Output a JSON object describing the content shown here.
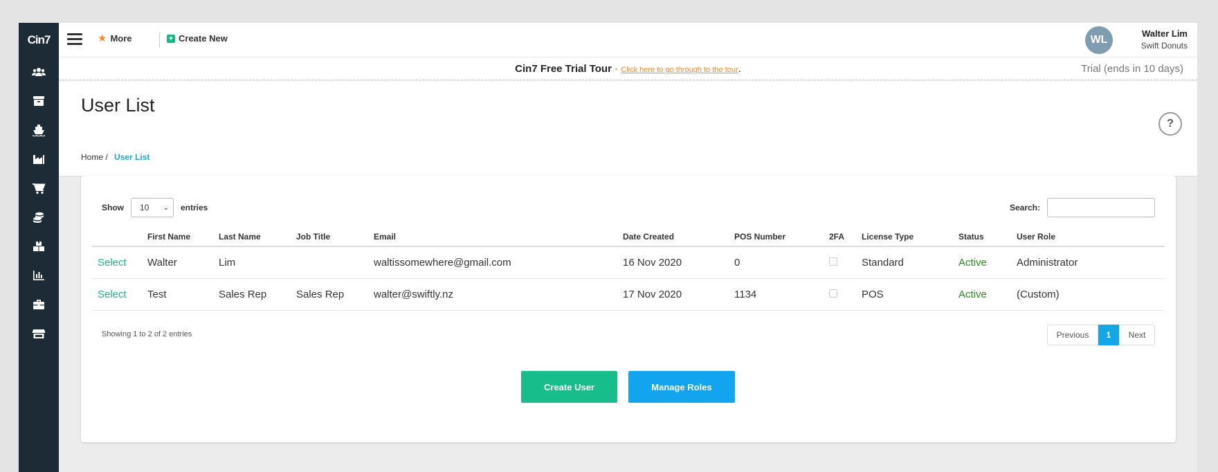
{
  "app": {
    "logo": "Cin7"
  },
  "sidebar": {
    "icons": [
      "users-icon",
      "box-icon",
      "ship-icon",
      "factory-icon",
      "cart-icon",
      "coins-icon",
      "warehouse-icon",
      "chart-icon",
      "briefcase-icon",
      "store-icon"
    ]
  },
  "topbar": {
    "more_label": "More",
    "create_new_label": "Create New",
    "avatar_initials": "WL",
    "user_name": "Walter Lim",
    "company": "Swift Donuts"
  },
  "banner": {
    "title": "Cin7 Free Trial Tour",
    "separator": " - ",
    "link_text": "Click here to go through to the tour",
    "suffix": ".",
    "trial_status": "Trial (ends in 10 days)"
  },
  "page": {
    "title": "User List",
    "breadcrumb_home": "Home",
    "breadcrumb_sep": "/",
    "breadcrumb_current": "User List",
    "help": "?"
  },
  "table_controls": {
    "show_label": "Show",
    "entries_value": "10",
    "entries_label": "entries",
    "search_label": "Search:",
    "search_value": ""
  },
  "table": {
    "columns": [
      "",
      "First Name",
      "Last Name",
      "Job Title",
      "Email",
      "Date Created",
      "POS Number",
      "2FA",
      "License Type",
      "Status",
      "User Role"
    ],
    "rows": [
      {
        "action": "Select",
        "first_name": "Walter",
        "last_name": "Lim",
        "job_title": "",
        "email": "waltissomewhere@gmail.com",
        "date_created": "16 Nov 2020",
        "pos_number": "0",
        "two_fa": false,
        "license_type": "Standard",
        "status": "Active",
        "user_role": "Administrator"
      },
      {
        "action": "Select",
        "first_name": "Test",
        "last_name": "Sales Rep",
        "job_title": "Sales Rep",
        "email": "walter@swiftly.nz",
        "date_created": "17 Nov 2020",
        "pos_number": "1134",
        "two_fa": false,
        "license_type": "POS",
        "status": "Active",
        "user_role": "(Custom)"
      }
    ]
  },
  "footer": {
    "info": "Showing 1 to 2 of 2 entries",
    "prev_label": "Previous",
    "current_page": "1",
    "next_label": "Next"
  },
  "actions": {
    "create_user_label": "Create User",
    "manage_roles_label": "Manage Roles"
  },
  "colors": {
    "sidebar": "#1d2b36",
    "accent_green": "#17bd8a",
    "accent_blue": "#12a4ee",
    "link_orange": "#f6892d",
    "status_active": "#2b8a1e"
  }
}
